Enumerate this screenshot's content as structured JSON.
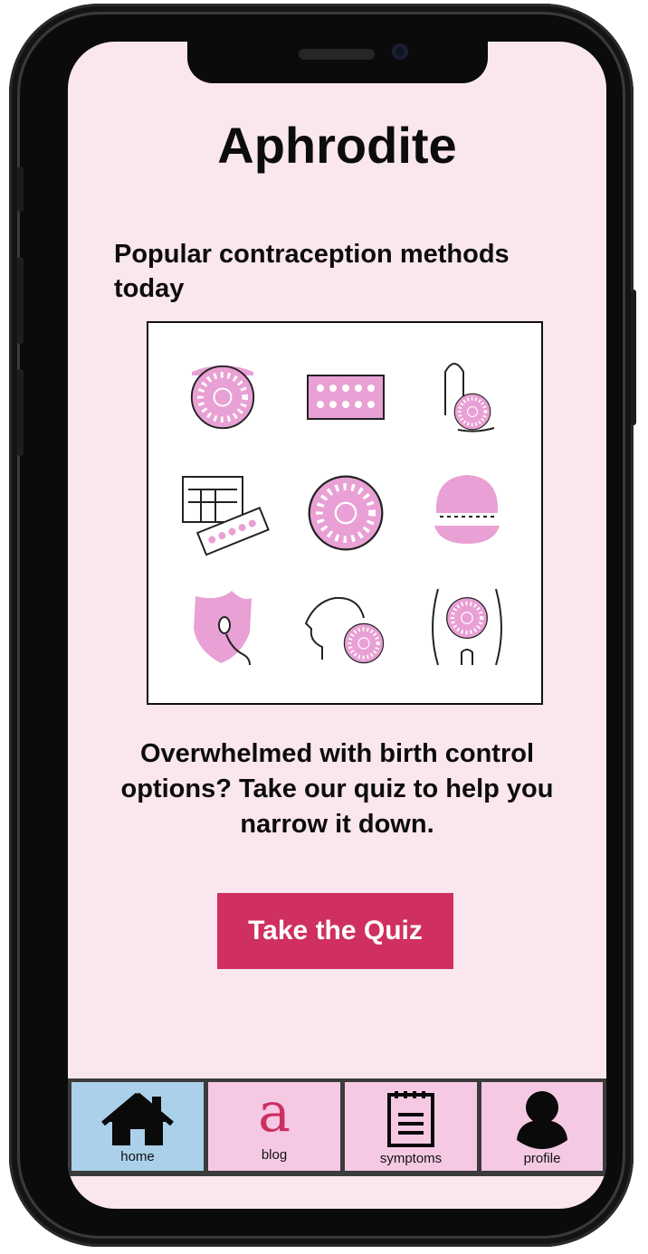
{
  "app": {
    "title": "Aphrodite"
  },
  "home": {
    "subtitle": "Popular contraception methods today",
    "quiz_prompt": "Overwhelmed with birth control options? Take our quiz to help you narrow it down.",
    "quiz_button": "Take the Quiz"
  },
  "nav": {
    "items": [
      {
        "label": "home",
        "icon": "home-icon",
        "active": true
      },
      {
        "label": "blog",
        "icon": "blog-a-icon",
        "active": false
      },
      {
        "label": "symptoms",
        "icon": "notepad-icon",
        "active": false
      },
      {
        "label": "profile",
        "icon": "user-icon",
        "active": false
      }
    ],
    "blog_glyph": "a"
  },
  "colors": {
    "screen_bg": "#fae6ee",
    "accent": "#cf3060",
    "nav_item": "#f5c9e3",
    "nav_active": "#abd1ea",
    "illustration_pink": "#e9a0d4"
  }
}
